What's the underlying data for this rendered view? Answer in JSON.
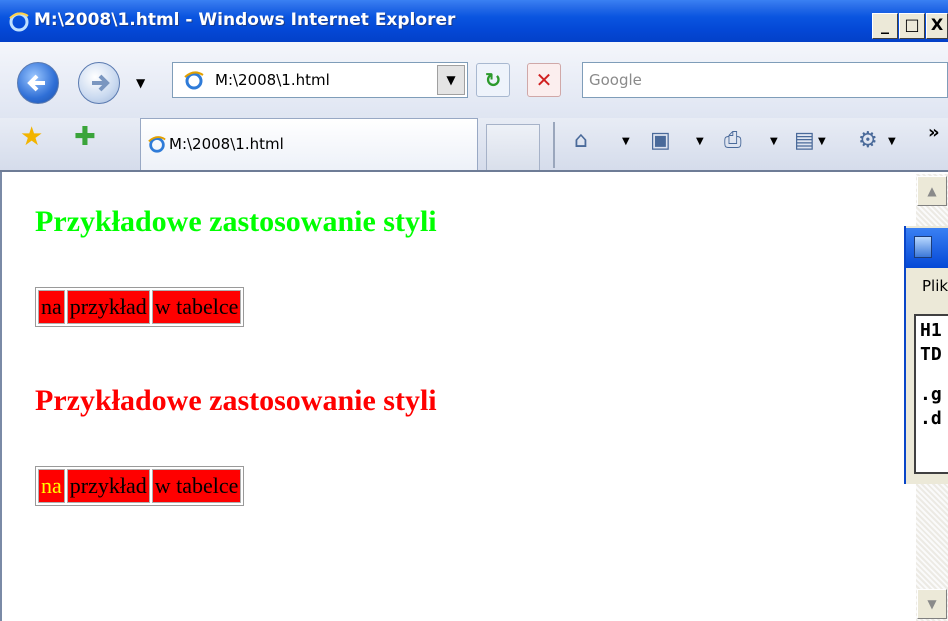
{
  "window": {
    "title": "M:\\2008\\1.html - Windows Internet Explorer",
    "controls": {
      "minimize": "_",
      "maximize": "□",
      "close": "X"
    }
  },
  "addressbar": {
    "url": "M:\\2008\\1.html",
    "search_placeholder": "Google"
  },
  "tabs": [
    {
      "label": "M:\\2008\\1.html"
    }
  ],
  "toolbar": {
    "icons": [
      "home-icon",
      "feeds-icon",
      "print-icon",
      "page-icon",
      "tools-icon"
    ],
    "overflow": "»"
  },
  "page": {
    "heading1": "Przykładowe zastosowanie styli",
    "table1": [
      "na",
      "przykład",
      "w tabelce"
    ],
    "heading2": "Przykładowe zastosowanie styli",
    "table2": [
      "na",
      "przykład",
      "w tabelce"
    ]
  },
  "notepad": {
    "menu_first": "Plik",
    "lines": [
      "H1",
      "TD",
      ".g",
      ".d"
    ]
  },
  "colors": {
    "heading1": "#00ff00",
    "heading2": "#ff0000",
    "cell_bg": "#ff0000",
    "cell_highlight_text": "#ffff00"
  }
}
